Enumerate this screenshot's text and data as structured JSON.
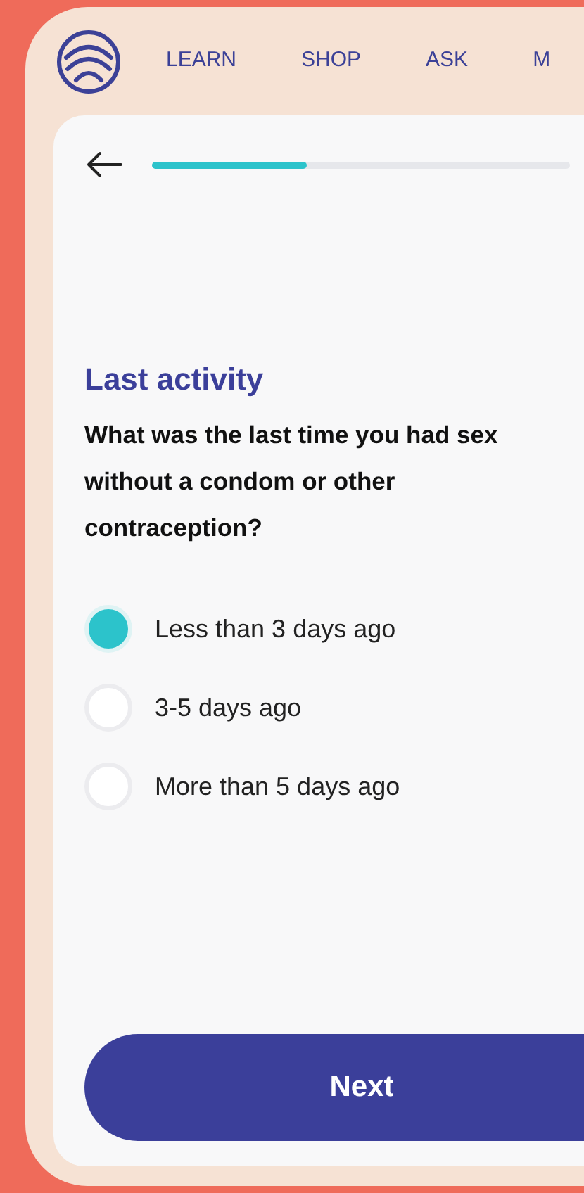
{
  "nav": {
    "links": [
      {
        "label": "LEARN"
      },
      {
        "label": "SHOP"
      },
      {
        "label": "ASK"
      },
      {
        "label": "M"
      }
    ]
  },
  "progress": {
    "level": 0.37
  },
  "question": {
    "title": "Last activity",
    "text": "What was the last time you had sex without a condom or other contraception?"
  },
  "options": [
    {
      "label": "Less than 3 days ago",
      "selected": true
    },
    {
      "label": "3-5 days ago",
      "selected": false
    },
    {
      "label": "More than 5 days ago",
      "selected": false
    }
  ],
  "next_button": {
    "label": "Next"
  }
}
